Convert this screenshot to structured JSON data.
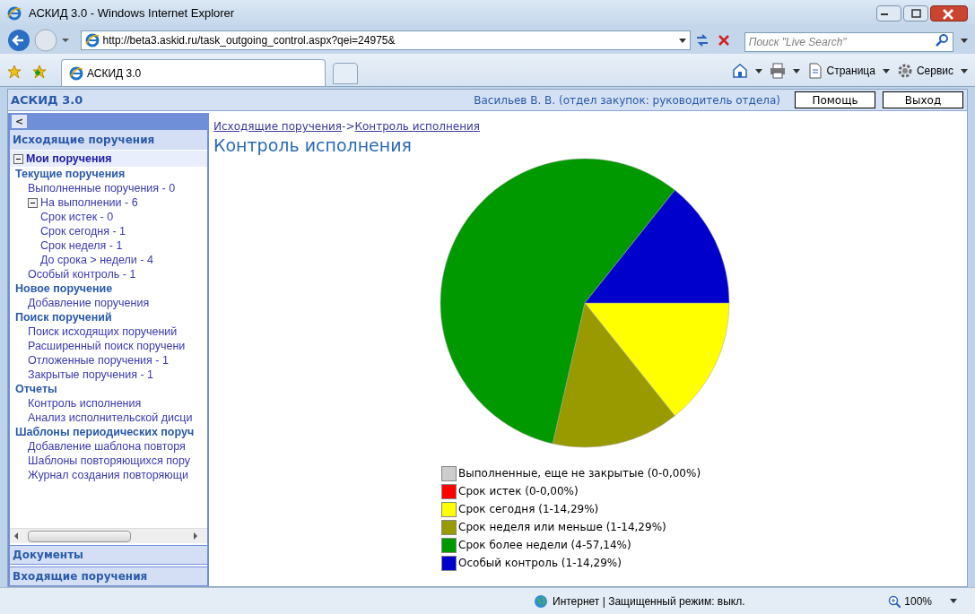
{
  "window": {
    "title": "АСКИД 3.0 - Windows Internet Explorer"
  },
  "address_bar": {
    "url": "http://beta3.askid.ru/task_outgoing_control.aspx?qei=24975&"
  },
  "search": {
    "placeholder": "Поиск \"Live Search\""
  },
  "tabs": [
    {
      "label": "АСКИД 3.0",
      "selected": true
    }
  ],
  "toolbar": [
    {
      "kind": "home"
    },
    {
      "kind": "print"
    },
    {
      "kind": "page",
      "label": "Страница"
    },
    {
      "kind": "tools",
      "label": "Сервис"
    }
  ],
  "app_header": {
    "title": "АСКИД 3.0",
    "user": "Васильев В. В. (отдел закупок: руководитель отдела)",
    "buttons": [
      "Помощь",
      "Выход"
    ]
  },
  "sidebar": {
    "collapse": "<",
    "section": "Исходящие поручения",
    "my_orders": {
      "label": "Мои поручения",
      "expanded": true
    },
    "groups": [
      {
        "label": "Текущие поручения",
        "children": [
          {
            "label": "Выполненные поручения - 0"
          },
          {
            "label": "На выполнении - 6",
            "expanded": true,
            "children": [
              {
                "label": "Срок истек - 0"
              },
              {
                "label": "Срок сегодня - 1"
              },
              {
                "label": "Срок неделя - 1"
              },
              {
                "label": "До срока > недели - 4"
              }
            ]
          },
          {
            "label": "Особый контроль - 1"
          }
        ]
      },
      {
        "label": "Новое поручение",
        "children": [
          {
            "label": "Добавление поручения"
          }
        ]
      },
      {
        "label": "Поиск поручений",
        "children": [
          {
            "label": "Поиск исходящих поручений"
          },
          {
            "label": "Расширенный поиск поручени"
          },
          {
            "label": "Отложенные поручения - 1"
          },
          {
            "label": "Закрытые поручения - 1"
          }
        ]
      },
      {
        "label": "Отчеты",
        "children": [
          {
            "label": "Контроль исполнения"
          },
          {
            "label": "Анализ исполнительской дисци"
          }
        ]
      },
      {
        "label": "Шаблоны периодических поруч",
        "children": [
          {
            "label": "Добавление шаблона повторя"
          },
          {
            "label": "Шаблоны повторяющихся пору"
          },
          {
            "label": "Журнал создания повторяющи"
          }
        ]
      }
    ],
    "bottom_sections": [
      "Документы",
      "Входящие поручения"
    ]
  },
  "breadcrumb": [
    "Исходящие поручения",
    "->",
    "Контроль исполнения"
  ],
  "page_title": "Контроль исполнения",
  "legend": [
    {
      "color": "#cccccc"
    },
    {
      "color": "#ff0000"
    },
    {
      "color": "#ffff00"
    },
    {
      "color": "#999900"
    },
    {
      "color": "#009900"
    },
    {
      "color": "#0000cc"
    }
  ],
  "chart_data": {
    "type": "pie",
    "categories": [
      "Выполненные, еще не закрытые (0-0,00%)",
      "Срок истек (0-0,00%)",
      "Срок сегодня (1-14,29%)",
      "Срок неделя или меньше (1-14,29%)",
      "Срок более недели (4-57,14%)",
      "Особый контроль (1-14,29%)"
    ],
    "values": [
      0,
      0,
      14.29,
      14.29,
      57.14,
      14.29
    ],
    "legend": "bottom"
  },
  "status_bar": {
    "zone": "Интернет | Защищенный режим: выкл.",
    "zoom": "100%"
  }
}
